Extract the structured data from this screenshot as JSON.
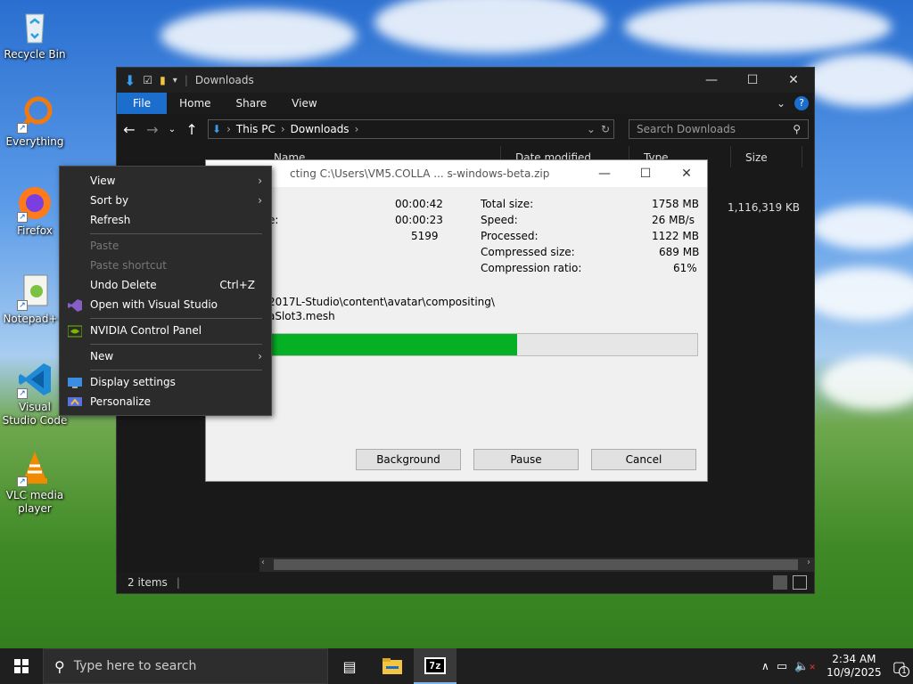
{
  "desktop": {
    "icons": [
      {
        "label": "Recycle Bin"
      },
      {
        "label": "Everything"
      },
      {
        "label": "Firefox"
      },
      {
        "label": "Notepad++"
      },
      {
        "label": "Visual Studio Code"
      },
      {
        "label": "VLC media player"
      }
    ]
  },
  "explorer": {
    "title": "Downloads",
    "ribbon_tabs": [
      "File",
      "Home",
      "Share",
      "View"
    ],
    "breadcrumb": [
      "This PC",
      "Downloads"
    ],
    "search_placeholder": "Search Downloads",
    "columns": [
      "Name",
      "Date modified",
      "Type",
      "Size"
    ],
    "file_size": "1,116,319 KB",
    "status": "2 items"
  },
  "extract_dialog": {
    "title": "cting C:\\Users\\VM5.COLLA ... s-windows-beta.zip",
    "left_stats": [
      {
        "label": "",
        "value": "00:00:42"
      },
      {
        "label": "e:",
        "value": "00:00:23"
      },
      {
        "label": "",
        "value": "5199"
      }
    ],
    "right_stats": [
      {
        "label": "Total size:",
        "value": "1758 MB"
      },
      {
        "label": "Speed:",
        "value": "26 MB/s"
      },
      {
        "label": "Processed:",
        "value": "1122 MB"
      },
      {
        "label": "Compressed size:",
        "value": "689 MB"
      },
      {
        "label": "Compression ratio:",
        "value": "61%"
      }
    ],
    "current_path_1": "2017L-Studio\\content\\avatar\\compositing\\",
    "current_path_2": "aSlot3.mesh",
    "progress": 0.58,
    "buttons": {
      "background": "Background",
      "pause": "Pause",
      "cancel": "Cancel"
    }
  },
  "context_menu": {
    "view": "View",
    "sort_by": "Sort by",
    "refresh": "Refresh",
    "paste": "Paste",
    "paste_shortcut": "Paste shortcut",
    "undo_delete": "Undo Delete",
    "undo_shortcut": "Ctrl+Z",
    "open_vs": "Open with Visual Studio",
    "nvidia": "NVIDIA Control Panel",
    "new": "New",
    "display_settings": "Display settings",
    "personalize": "Personalize"
  },
  "taskbar": {
    "search_placeholder": "Type here to search",
    "time": "2:34 AM",
    "date": "10/9/2025",
    "notification_count": "1"
  },
  "colors": {
    "accent": "#1b6ecc",
    "progress": "#06b025"
  }
}
